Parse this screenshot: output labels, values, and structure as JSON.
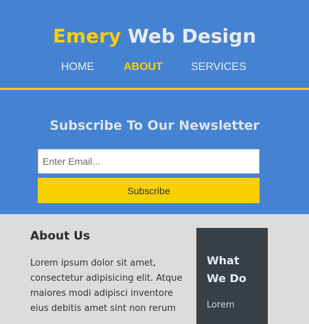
{
  "brand": {
    "highlight": "Emery",
    "rest": " Web Design"
  },
  "nav": {
    "home": "HOME",
    "about": "ABOUT",
    "services": "SERVICES",
    "active": "about"
  },
  "newsletter": {
    "title": "Subscribe To Our Newsletter",
    "email_placeholder": "Enter Email...",
    "email_value": "",
    "subscribe_label": "Subscribe"
  },
  "about": {
    "title": "About Us",
    "text": "Lorem ipsum dolor sit amet, consectetur adipisicing elit. Atque maiores modi adipisci inventore eius debitis amet sint non rerum"
  },
  "sidebar": {
    "title": "What We Do",
    "text": "Lorem"
  },
  "colors": {
    "header_bg": "#4582d2",
    "accent": "#f8d000",
    "sidebar_bg": "#373f47",
    "content_bg": "#dcdcdc"
  }
}
